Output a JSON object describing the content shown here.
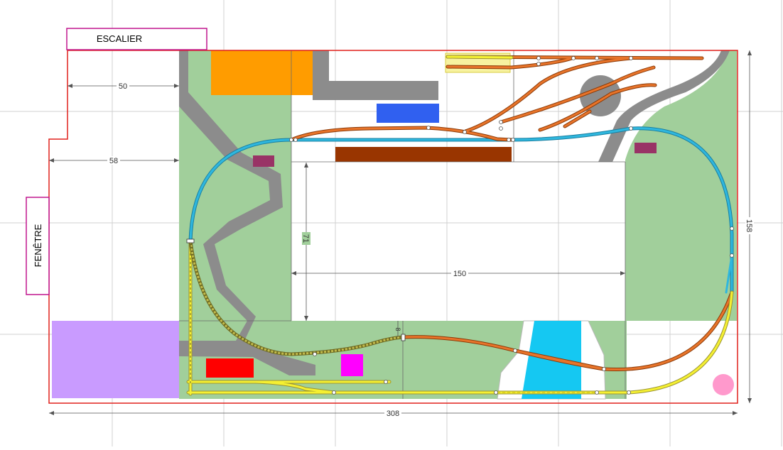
{
  "labels": {
    "stairs": "ESCALIER",
    "window": "FENÊTRE"
  },
  "dimensions": {
    "d50": "50",
    "d58": "58",
    "d71": "71",
    "d150": "150",
    "d158": "158",
    "d308": "308",
    "d8": "8"
  },
  "colors": {
    "outline": "#e0201c",
    "grass": "#a1cf9b",
    "road": "#8c8c8c",
    "track_blue": "#2fb7de",
    "track_orange": "#d9691c",
    "track_yellow": "#f5f032",
    "track_olive": "#9a9433",
    "water": "#15c8f2",
    "label_box": "#c0168e"
  }
}
